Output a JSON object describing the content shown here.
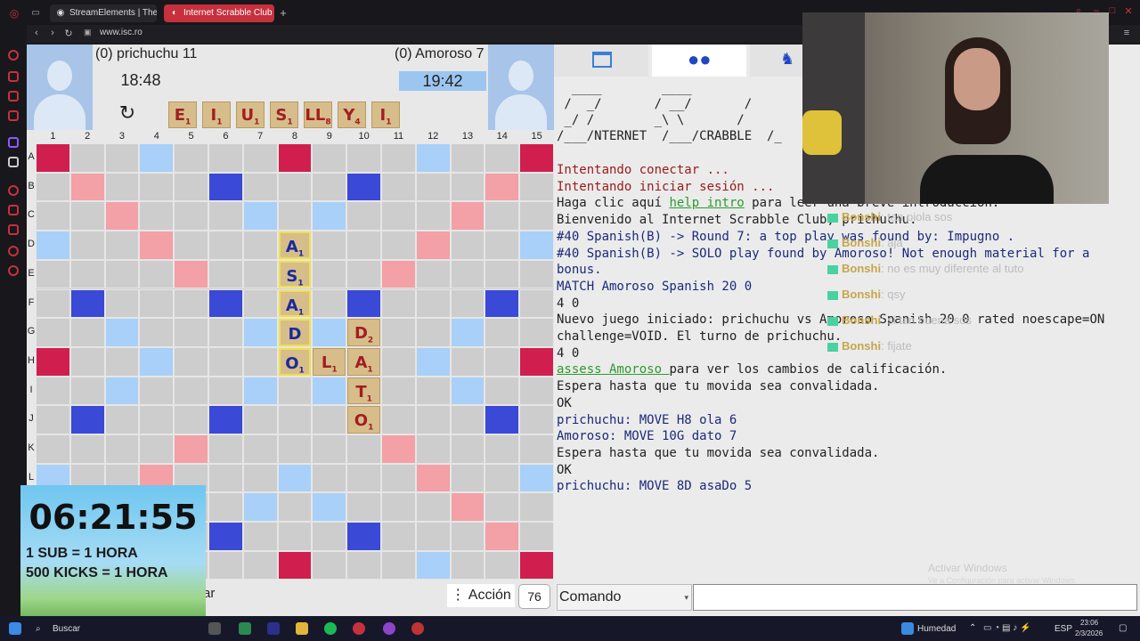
{
  "browser": {
    "tabs": [
      {
        "label": "StreamElements | The Ulti",
        "active": false
      },
      {
        "label": "Internet Scrabble Club",
        "active": true
      }
    ],
    "new_tab": "+",
    "url": "www.isc.ro"
  },
  "players": {
    "left": {
      "name": "(0) prichuchu 11",
      "clock": "18:48"
    },
    "right": {
      "name": "(0) Amoroso 7",
      "clock": "19:42"
    }
  },
  "rack": [
    {
      "letter": "E",
      "value": "1"
    },
    {
      "letter": "I",
      "value": "1"
    },
    {
      "letter": "U",
      "value": "1"
    },
    {
      "letter": "S",
      "value": "1"
    },
    {
      "letter": "LL",
      "value": "8"
    },
    {
      "letter": "Y",
      "value": "4"
    },
    {
      "letter": "I",
      "value": "1"
    }
  ],
  "board": {
    "columns": [
      "1",
      "2",
      "3",
      "4",
      "5",
      "6",
      "7",
      "8",
      "9",
      "10",
      "11",
      "12",
      "13",
      "14",
      "15"
    ],
    "rows": [
      "A",
      "B",
      "C",
      "D",
      "E",
      "F",
      "G",
      "H",
      "I",
      "J",
      "K",
      "L"
    ],
    "tiles": [
      {
        "row": 3,
        "col": 7,
        "letter": "A",
        "value": "1",
        "last": true
      },
      {
        "row": 4,
        "col": 7,
        "letter": "S",
        "value": "1",
        "last": true
      },
      {
        "row": 5,
        "col": 7,
        "letter": "A",
        "value": "1",
        "last": true
      },
      {
        "row": 6,
        "col": 7,
        "letter": "D",
        "value": "",
        "last": true
      },
      {
        "row": 7,
        "col": 7,
        "letter": "O",
        "value": "1",
        "last": true
      },
      {
        "row": 7,
        "col": 8,
        "letter": "L",
        "value": "1",
        "last": false
      },
      {
        "row": 7,
        "col": 9,
        "letter": "A",
        "value": "1",
        "last": false
      },
      {
        "row": 6,
        "col": 9,
        "letter": "D",
        "value": "2",
        "last": false
      },
      {
        "row": 8,
        "col": 9,
        "letter": "T",
        "value": "1",
        "last": false
      },
      {
        "row": 9,
        "col": 9,
        "letter": "O",
        "value": "1",
        "last": false
      }
    ]
  },
  "actions": {
    "accion_label": "⋮ Acción",
    "fragment": "ar",
    "bag_count": "76"
  },
  "console": {
    "ascii": [
      "  ____        ____",
      " /  _/       / __/       /",
      " _/ /        _\\ \\       /",
      "/___/NTERNET  /___/CRABBLE  /_"
    ],
    "lines": [
      {
        "text": "Intentando conectar ...",
        "style": "red"
      },
      {
        "text": "Intentando iniciar sesión ...",
        "style": "red"
      },
      {
        "pre": "Haga clic aquí ",
        "link": "help intro",
        "post": " para leer una breve introducción.",
        "style": "link"
      },
      {
        "text": "Bienvenido al Internet Scrabble Club, prichuchu.",
        "style": "plain"
      },
      {
        "text": "#40 Spanish(B) -> Round 7: a top play was found by: Impugno .",
        "style": "navy"
      },
      {
        "text": "#40 Spanish(B) -> SOLO play found by Amoroso! Not enough material for a",
        "style": "navy"
      },
      {
        "text": "bonus.",
        "style": "navy"
      },
      {
        "text": "MATCH Amoroso Spanish 20 0",
        "style": "navy"
      },
      {
        "text": "4 0",
        "style": "plain"
      },
      {
        "text": "Nuevo juego iniciado: prichuchu vs Amoroso Spanish 20 0 rated noescape=ON",
        "style": "plain"
      },
      {
        "text": "challenge=VOID. El turno de prichuchu.",
        "style": "plain"
      },
      {
        "text": "4 0",
        "style": "plain"
      },
      {
        "pre": "",
        "link": "assess Amoroso ",
        "post": "para ver los cambios de calificación.",
        "style": "link"
      },
      {
        "text": "Espera hasta que tu movida sea convalidada.",
        "style": "plain"
      },
      {
        "text": "OK",
        "style": "plain"
      },
      {
        "text": "prichuchu: MOVE H8 ola 6",
        "style": "navy"
      },
      {
        "text": "Amoroso: MOVE 10G dato 7",
        "style": "navy"
      },
      {
        "text": "Espera hasta que tu movida sea convalidada.",
        "style": "plain"
      },
      {
        "text": "OK",
        "style": "plain"
      },
      {
        "text": "prichuchu: MOVE 8D asaDo 5",
        "style": "navy"
      }
    ],
    "command_select": "Comando",
    "command_value": ""
  },
  "watermark": {
    "title": "Activar Windows",
    "subtitle": "Ve a Configuración para activar Windows."
  },
  "chat": [
    {
      "user": "Bonshi",
      "msg": ": tan piola sos"
    },
    {
      "user": "Bonshi",
      "msg": ": aja"
    },
    {
      "user": "Bonshi",
      "msg": ": no es muy diferente al tuto"
    },
    {
      "user": "Bonshi",
      "msg": ": qsy"
    },
    {
      "user": "Bonshi",
      "msg": ": si tan buena sos"
    },
    {
      "user": "Bonshi",
      "msg": ": fijate"
    }
  ],
  "subathon": {
    "time": "06:21:55",
    "line1": "1 SUB = 1 HORA",
    "line2": "500 KICKS = 1 HORA"
  },
  "taskbar": {
    "search": "Buscar",
    "weather": "Humedad",
    "lang": "ESP",
    "time": "23:06",
    "date": "2/3/2026"
  },
  "colors": {
    "triple_word": "#d01f4e",
    "double_word": "#f3a0a6",
    "triple_letter": "#3a49d6",
    "double_letter": "#a8d0f8",
    "tile": "#d7bd8a",
    "tab_active": "#c8303e"
  }
}
